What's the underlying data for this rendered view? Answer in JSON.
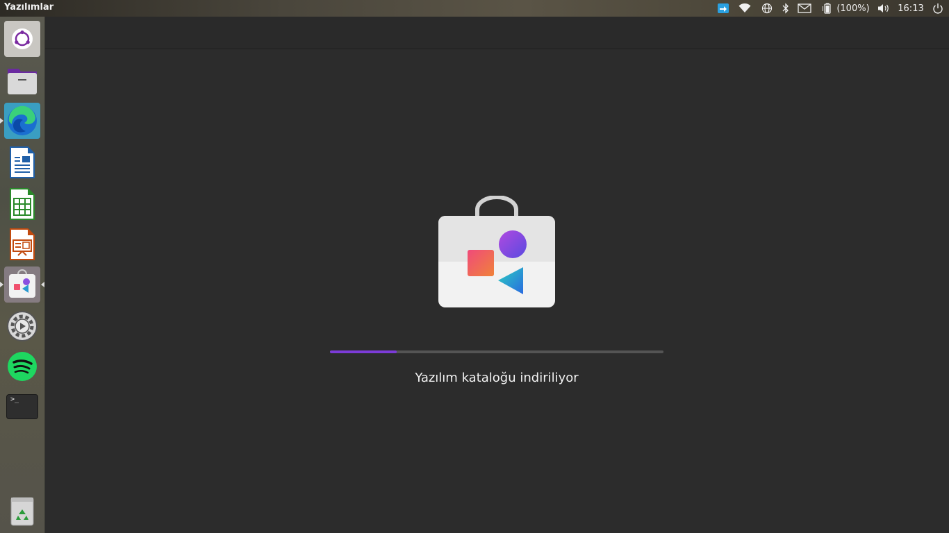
{
  "topbar": {
    "app_title": "Yazılımlar",
    "battery_text": "(100%)",
    "clock": "16:13",
    "tray_icons": [
      "remote-desktop-icon",
      "wifi-icon",
      "network-globe-icon",
      "bluetooth-icon",
      "mail-icon",
      "battery-icon",
      "volume-icon",
      "power-icon"
    ]
  },
  "launcher": {
    "items": [
      {
        "name": "ubuntu-logo-icon"
      },
      {
        "name": "files-icon"
      },
      {
        "name": "edge-browser-icon"
      },
      {
        "name": "libreoffice-writer-icon"
      },
      {
        "name": "libreoffice-calc-icon"
      },
      {
        "name": "libreoffice-impress-icon"
      },
      {
        "name": "software-store-icon",
        "active": true
      },
      {
        "name": "settings-icon"
      },
      {
        "name": "spotify-icon"
      },
      {
        "name": "terminal-icon"
      },
      {
        "name": "trash-icon"
      }
    ],
    "terminal_prompt": ">_"
  },
  "main": {
    "status_text": "Yazılım kataloğu indiriliyor",
    "progress": 0.2
  },
  "colors": {
    "accent": "#7c3bd8",
    "background": "#2c2c2c"
  }
}
